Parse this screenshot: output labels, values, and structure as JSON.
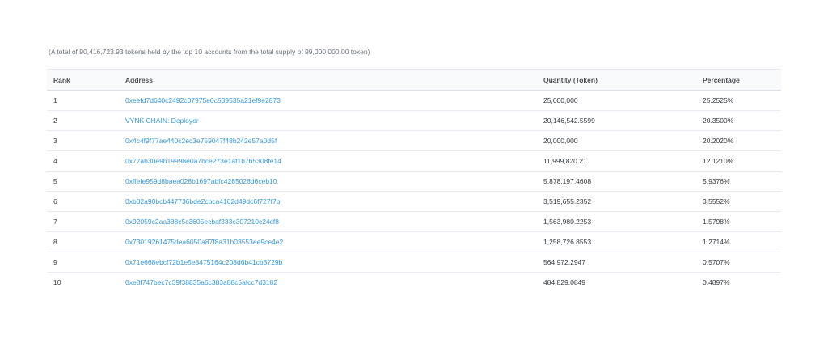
{
  "summary": "(A total of 90,416,723.93 tokens held by the top 10 accounts from the total supply of 99,000,000.00 token)",
  "table": {
    "headers": {
      "rank": "Rank",
      "address": "Address",
      "quantity": "Quantity (Token)",
      "percentage": "Percentage"
    },
    "rows": [
      {
        "rank": "1",
        "address": "0xeefd7d640c2492c07975e0c539535a21ef9e2873",
        "quantity": "25,000,000",
        "percentage": "25.2525%"
      },
      {
        "rank": "2",
        "address": "VYNK CHAIN: Deployer",
        "quantity": "20,146,542.5599",
        "percentage": "20.3500%"
      },
      {
        "rank": "3",
        "address": "0x4c4f9f77ae440c2ec3e759047f48b242e57a0d5f",
        "quantity": "20,000,000",
        "percentage": "20.2020%"
      },
      {
        "rank": "4",
        "address": "0x77ab30e9b19998e0a7bce273e1af1b7b5308fe14",
        "quantity": "11,999,820.21",
        "percentage": "12.1210%"
      },
      {
        "rank": "5",
        "address": "0xffefe959d8baea028b1697abfc4285028d6ceb10",
        "quantity": "5,878,197.4608",
        "percentage": "5.9376%"
      },
      {
        "rank": "6",
        "address": "0xb02a90bcb447736bde2cbca4102d49dc6f727f7b",
        "quantity": "3,519,655.2352",
        "percentage": "3.5552%"
      },
      {
        "rank": "7",
        "address": "0x92059c2aa388c5c3605ecbaf333c307210c24cf8",
        "quantity": "1,563,980.2253",
        "percentage": "1.5798%"
      },
      {
        "rank": "8",
        "address": "0x73019261475dea6050a87f8a31b03553ee9ce4e2",
        "quantity": "1,258,726.8553",
        "percentage": "1.2714%"
      },
      {
        "rank": "9",
        "address": "0x71e668ebcf72b1e5e8475164c208d6b41cb3729b",
        "quantity": "564,972.2947",
        "percentage": "0.5707%"
      },
      {
        "rank": "10",
        "address": "0xe8f747bec7c39f38835a6c383a88c5afcc7d3182",
        "quantity": "484,829.0849",
        "percentage": "0.4897%"
      }
    ]
  },
  "colors": {
    "link": "#3498db",
    "header_bg": "#f8f9fa",
    "border": "#e7eaf3"
  }
}
